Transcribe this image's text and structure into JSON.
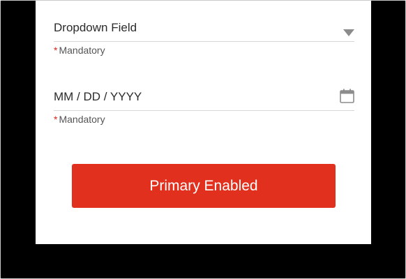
{
  "form": {
    "dropdown": {
      "value": "Dropdown Field",
      "hint_asterisk": "*",
      "hint": "Mandatory"
    },
    "date": {
      "placeholder": "MM / DD / YYYY",
      "hint_asterisk": "*",
      "hint": "Mandatory"
    },
    "primary_button_label": "Primary Enabled"
  },
  "icons": {
    "dropdown_caret": "chevron-down-icon",
    "date_picker": "calendar-icon"
  },
  "colors": {
    "primary": "#e1301d",
    "required": "#e2231a",
    "background": "#000000",
    "card": "#ffffff"
  }
}
